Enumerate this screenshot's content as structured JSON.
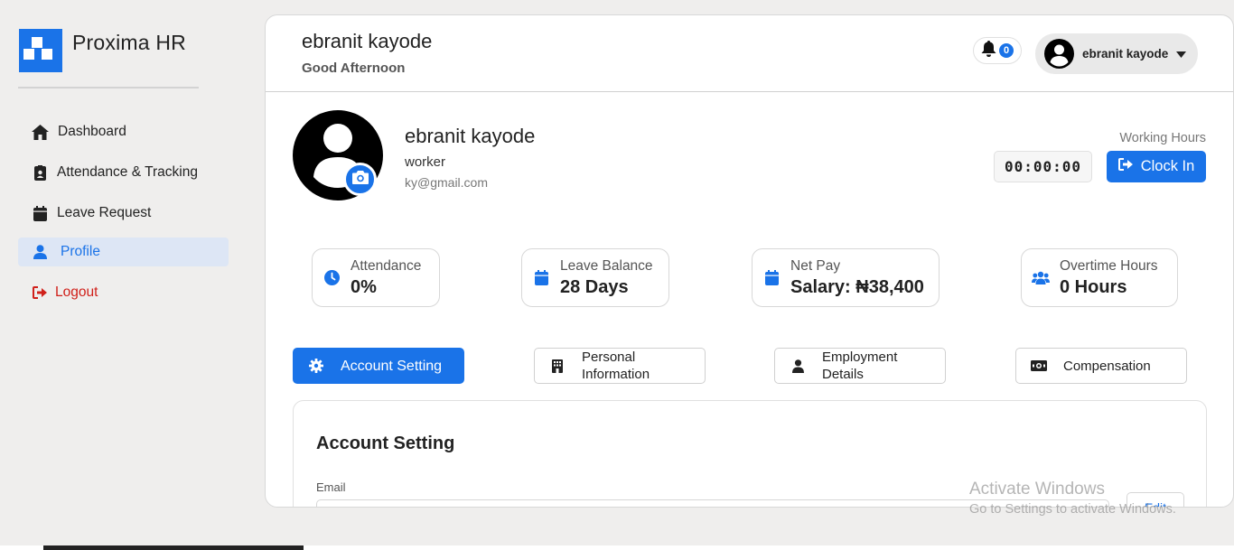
{
  "brand": {
    "name": "Proxima HR"
  },
  "sidebar": {
    "items": [
      {
        "label": "Dashboard",
        "icon": "home-icon"
      },
      {
        "label": "Attendance & Tracking",
        "icon": "id-badge-icon"
      },
      {
        "label": "Leave Request",
        "icon": "calendar-icon"
      },
      {
        "label": "Profile",
        "icon": "user-icon",
        "active": true
      },
      {
        "label": "Logout",
        "icon": "logout-icon"
      }
    ]
  },
  "header": {
    "name": "ebranit kayode",
    "greeting": "Good Afternoon",
    "notifications": "0",
    "user_name": "ebranit kayode"
  },
  "profile": {
    "name": "ebranit kayode",
    "role": "worker",
    "email": "ky@gmail.com",
    "working_hours_label": "Working Hours",
    "timer": "00:00:00",
    "clock_in_label": "Clock In"
  },
  "stats": [
    {
      "label": "Attendance",
      "value": "0%",
      "icon": "clock-icon"
    },
    {
      "label": "Leave Balance",
      "value": "28 Days",
      "icon": "calendar-icon"
    },
    {
      "label": "Net Pay",
      "value": "Salary: ₦38,400",
      "icon": "calendar-icon"
    },
    {
      "label": "Overtime Hours",
      "value": "0 Hours",
      "icon": "users-icon"
    }
  ],
  "tabs": [
    {
      "label": "Account Setting",
      "icon": "gear-icon",
      "active": true
    },
    {
      "label": "Personal Information",
      "icon": "building-icon"
    },
    {
      "label": "Employment Details",
      "icon": "user-icon"
    },
    {
      "label": "Compensation",
      "icon": "money-icon"
    }
  ],
  "account_setting": {
    "title": "Account Setting",
    "email_label": "Email",
    "email_value": "",
    "edit_label": "Edit"
  },
  "watermark": {
    "line1": "Activate Windows",
    "line2": "Go to Settings to activate Windows."
  },
  "colors": {
    "primary": "#1a73e8",
    "danger": "#d0201a",
    "active_bg": "#dde6f5"
  }
}
